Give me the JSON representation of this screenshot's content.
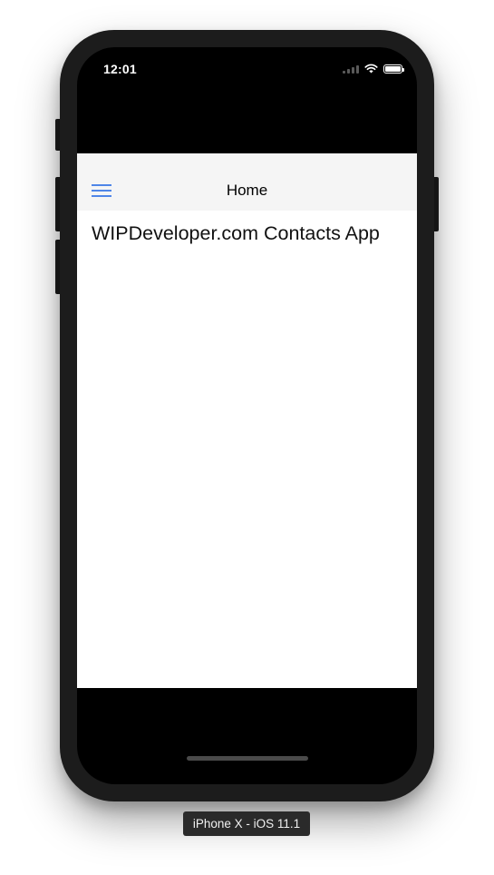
{
  "status_bar": {
    "time": "12:01",
    "icons": [
      "signal-icon",
      "wifi-icon",
      "battery-icon"
    ]
  },
  "nav": {
    "menu_icon": "hamburger-menu-icon",
    "title": "Home"
  },
  "main": {
    "heading": "WIPDeveloper.com Contacts App"
  },
  "simulator": {
    "device_label": "iPhone X - iOS 11.1"
  },
  "colors": {
    "accent": "#4f86e8",
    "nav_background": "#f5f5f5",
    "device_frame": "#1c1c1c",
    "screen_background": "#000000"
  }
}
